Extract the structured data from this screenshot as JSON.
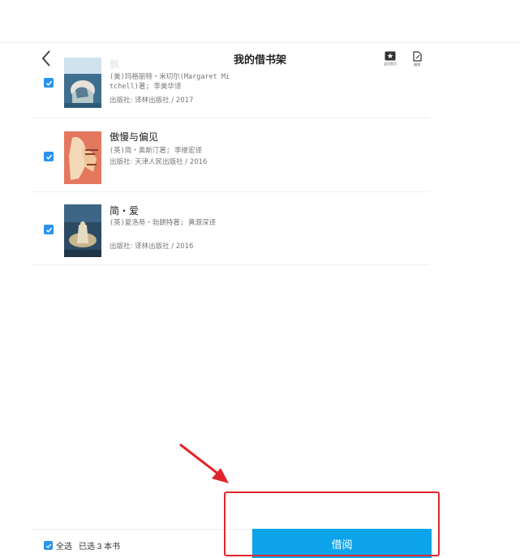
{
  "header": {
    "title": "我的借书架",
    "tools": [
      {
        "label": "返回首页",
        "icon": "bookmark-star-icon"
      },
      {
        "label": "编辑",
        "icon": "edit-doc-icon"
      }
    ]
  },
  "books": [
    {
      "title": "飘",
      "author": "(美)玛格丽特・米切尔(Margaret Mitchell)著; 李美华译",
      "publisher": "出版社: 译林出版社 / 2017",
      "checked": true
    },
    {
      "title": "傲慢与偏见",
      "author": "(英)简・奥斯汀著; 李继宏译",
      "publisher": "出版社: 天津人民出版社 / 2016",
      "checked": true
    },
    {
      "title": "简・爱",
      "author": "(英)夏洛蒂・勃朗特著; 黄源深译",
      "publisher": "出版社: 译林出版社 / 2016",
      "checked": true
    }
  ],
  "footer": {
    "select_all_label": "全选",
    "selected_count": "已选 3 本书",
    "borrow_label": "借阅"
  },
  "colors": {
    "accent": "#2a93ee",
    "button": "#0ea4ec",
    "highlight": "#e0262b"
  }
}
